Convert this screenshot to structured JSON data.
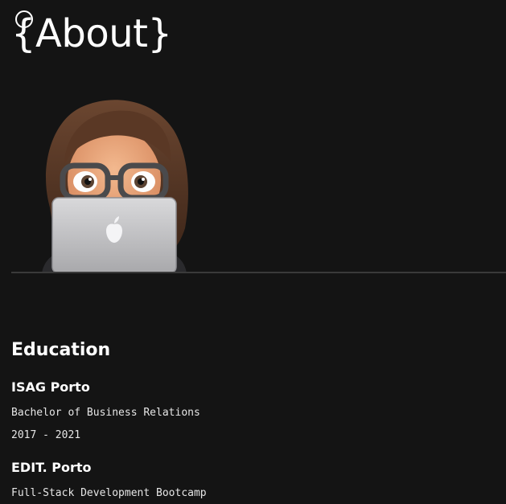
{
  "header": {
    "title": "{About}"
  },
  "avatar": {
    "icon": "memoji-laptop-icon"
  },
  "education": {
    "heading": "Education",
    "entries": [
      {
        "school": "ISAG Porto",
        "degree": "Bachelor of Business Relations",
        "years": "2017 - 2021"
      },
      {
        "school": "EDIT. Porto",
        "degree": "Full-Stack Development Bootcamp"
      }
    ]
  },
  "colors": {
    "background": "#141414",
    "text": "#ffffff",
    "divider": "#3a3a3a"
  }
}
